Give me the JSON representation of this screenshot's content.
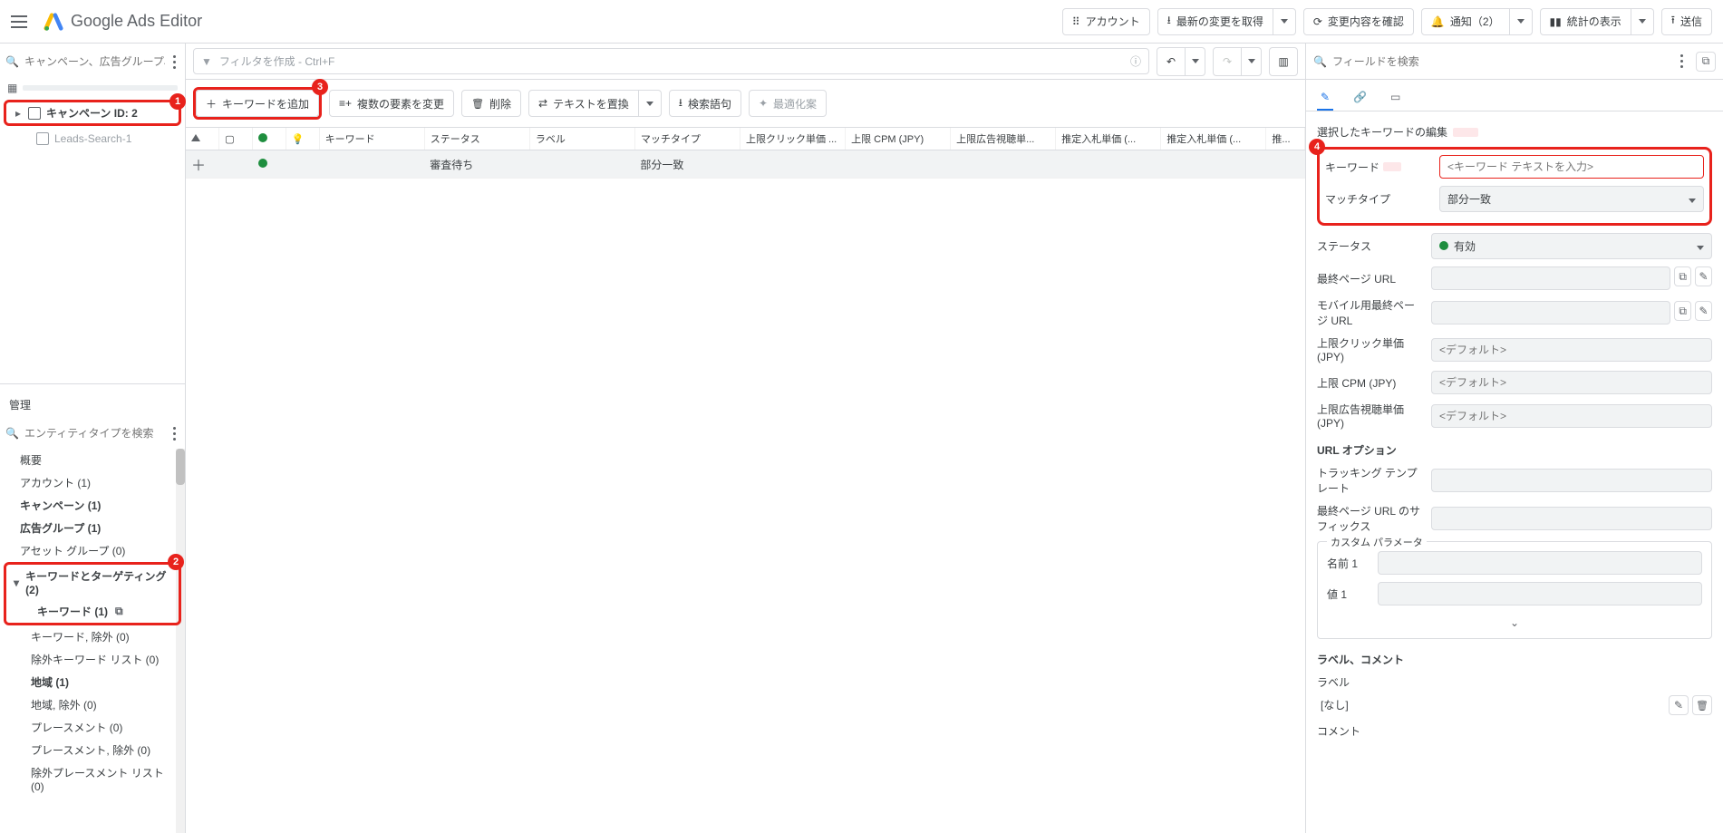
{
  "brand": {
    "title": "Google Ads Editor"
  },
  "topbar": {
    "account": "アカウント",
    "get_changes": "最新の変更を取得",
    "check_changes": "変更内容を確認",
    "notifications": "通知（2）",
    "stats": "統計の表示",
    "send": "送信"
  },
  "left": {
    "search_placeholder": "キャンペーン、広告グループ、アセ...",
    "campaign_id": "キャンペーン ID: 2",
    "campaign_child": "Leads-Search-1",
    "management_label": "管理",
    "entity_search_placeholder": "エンティティタイプを検索",
    "nav": {
      "overview": "概要",
      "account": "アカウント (1)",
      "campaigns": "キャンペーン (1)",
      "adgroups": "広告グループ (1)",
      "assetgroups": "アセット グループ (0)",
      "kw_targeting": "キーワードとターゲティング (2)",
      "keywords": "キーワード (1)",
      "neg_kw": "キーワード, 除外 (0)",
      "neg_kw_list": "除外キーワード リスト (0)",
      "locations": "地域 (1)",
      "locations_neg": "地域, 除外 (0)",
      "placements": "プレースメント (0)",
      "placements_neg": "プレースメント, 除外 (0)",
      "neg_placement_list": "除外プレースメント リスト (0)"
    }
  },
  "badges": {
    "b1": "1",
    "b2": "2",
    "b3": "3",
    "b4": "4"
  },
  "center": {
    "filter_placeholder": "フィルタを作成 - Ctrl+F",
    "add_keyword": "キーワードを追加",
    "multi_edit": "複数の要素を変更",
    "delete": "削除",
    "replace_text": "テキストを置換",
    "search_terms": "検索語句",
    "optimize": "最適化案",
    "columns": [
      "",
      "",
      "",
      "",
      "キーワード",
      "ステータス",
      "ラベル",
      "マッチタイプ",
      "上限クリック単価 ...",
      "上限 CPM (JPY)",
      "上限広告視聴単...",
      "推定入札単価 (...",
      "推定入札単価 (...",
      "推..."
    ],
    "row": {
      "status": "審査待ち",
      "match_type": "部分一致"
    }
  },
  "right": {
    "search_placeholder": "フィールドを検索",
    "panel_title": "選択したキーワードの編集",
    "keyword_label": "キーワード",
    "keyword_placeholder": "<キーワード テキストを入力>",
    "match_type_label": "マッチタイプ",
    "match_type_value": "部分一致",
    "status_label": "ステータス",
    "status_value": "有効",
    "final_url_label": "最終ページ URL",
    "mobile_url_label": "モバイル用最終ページ URL",
    "max_cpc_label": "上限クリック単価 (JPY)",
    "max_cpm_label": "上限 CPM (JPY)",
    "max_cpv_label": "上限広告視聴単価 (JPY)",
    "default_placeholder": "<デフォルト>",
    "url_options_head": "URL オプション",
    "tracking_template_label": "トラッキング テンプレート",
    "final_url_suffix_label": "最終ページ URL のサフィックス",
    "custom_params_head": "カスタム パラメータ",
    "name1": "名前 1",
    "value1": "値 1",
    "label_comment_head": "ラベル、コメント",
    "label_label": "ラベル",
    "label_none": "[なし]",
    "comment_label": "コメント"
  }
}
